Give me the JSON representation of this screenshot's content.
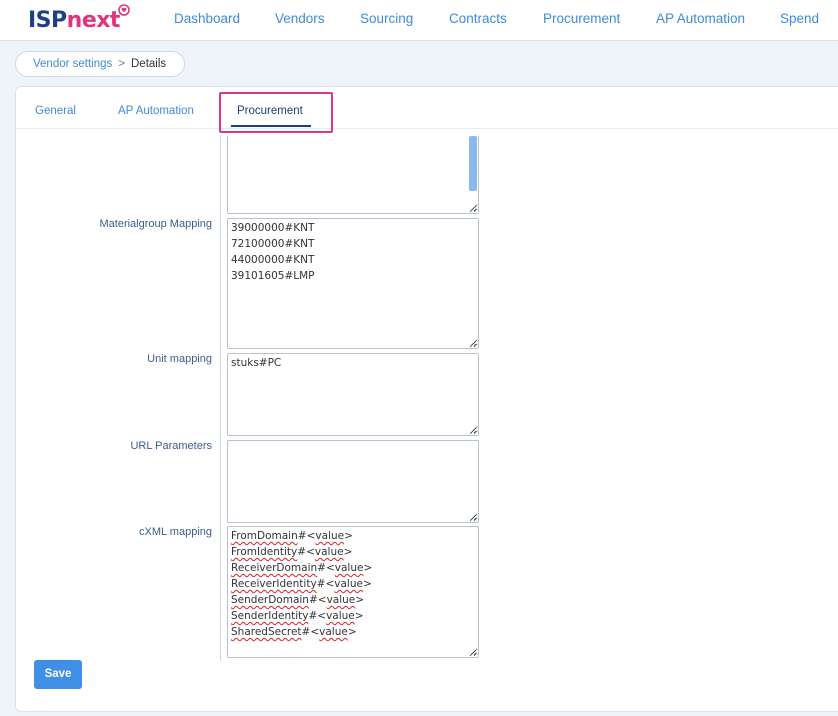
{
  "brand": {
    "part1": "ISP",
    "part2": "next"
  },
  "nav": {
    "dashboard": "Dashboard",
    "vendors": "Vendors",
    "sourcing": "Sourcing",
    "contracts": "Contracts",
    "procurement": "Procurement",
    "ap_automation": "AP Automation",
    "spend": "Spend"
  },
  "breadcrumb": {
    "parent": "Vendor settings",
    "separator": ">",
    "current": "Details"
  },
  "tabs": {
    "general": "General",
    "ap_automation": "AP Automation",
    "procurement": "Procurement"
  },
  "fields": {
    "materialgroup": {
      "label": "Materialgroup Mapping",
      "lines": [
        "39000000#KNT",
        "72100000#KNT",
        "44000000#KNT",
        "39101605#LMP"
      ]
    },
    "unit": {
      "label": "Unit mapping",
      "lines": [
        "stuks#PC"
      ]
    },
    "url": {
      "label": "URL Parameters"
    },
    "cxml": {
      "label": "cXML mapping",
      "lines": [
        {
          "word": "FromDomain",
          "rest": "#<",
          "val": "value",
          "end": ">"
        },
        {
          "word": "FromIdentity",
          "rest": "#<",
          "val": "value",
          "end": ">"
        },
        {
          "word": "ReceiverDomain",
          "rest": "#<",
          "val": "value",
          "end": ">"
        },
        {
          "word": "ReceiverIdentity",
          "rest": "#<",
          "val": "value",
          "end": ">"
        },
        {
          "word": "SenderDomain",
          "rest": "#<",
          "val": "value",
          "end": ">"
        },
        {
          "word": "SenderIdentity",
          "rest": "#<",
          "val": "value",
          "end": ">"
        },
        {
          "word": "SharedSecret",
          "rest": "#<",
          "val": "value",
          "end": ">"
        }
      ]
    }
  },
  "actions": {
    "save": "Save"
  },
  "colors": {
    "accent": "#3f8bd9",
    "brand_blue": "#1d3f86",
    "brand_pink": "#e0357d",
    "highlight": "#d9378a"
  }
}
